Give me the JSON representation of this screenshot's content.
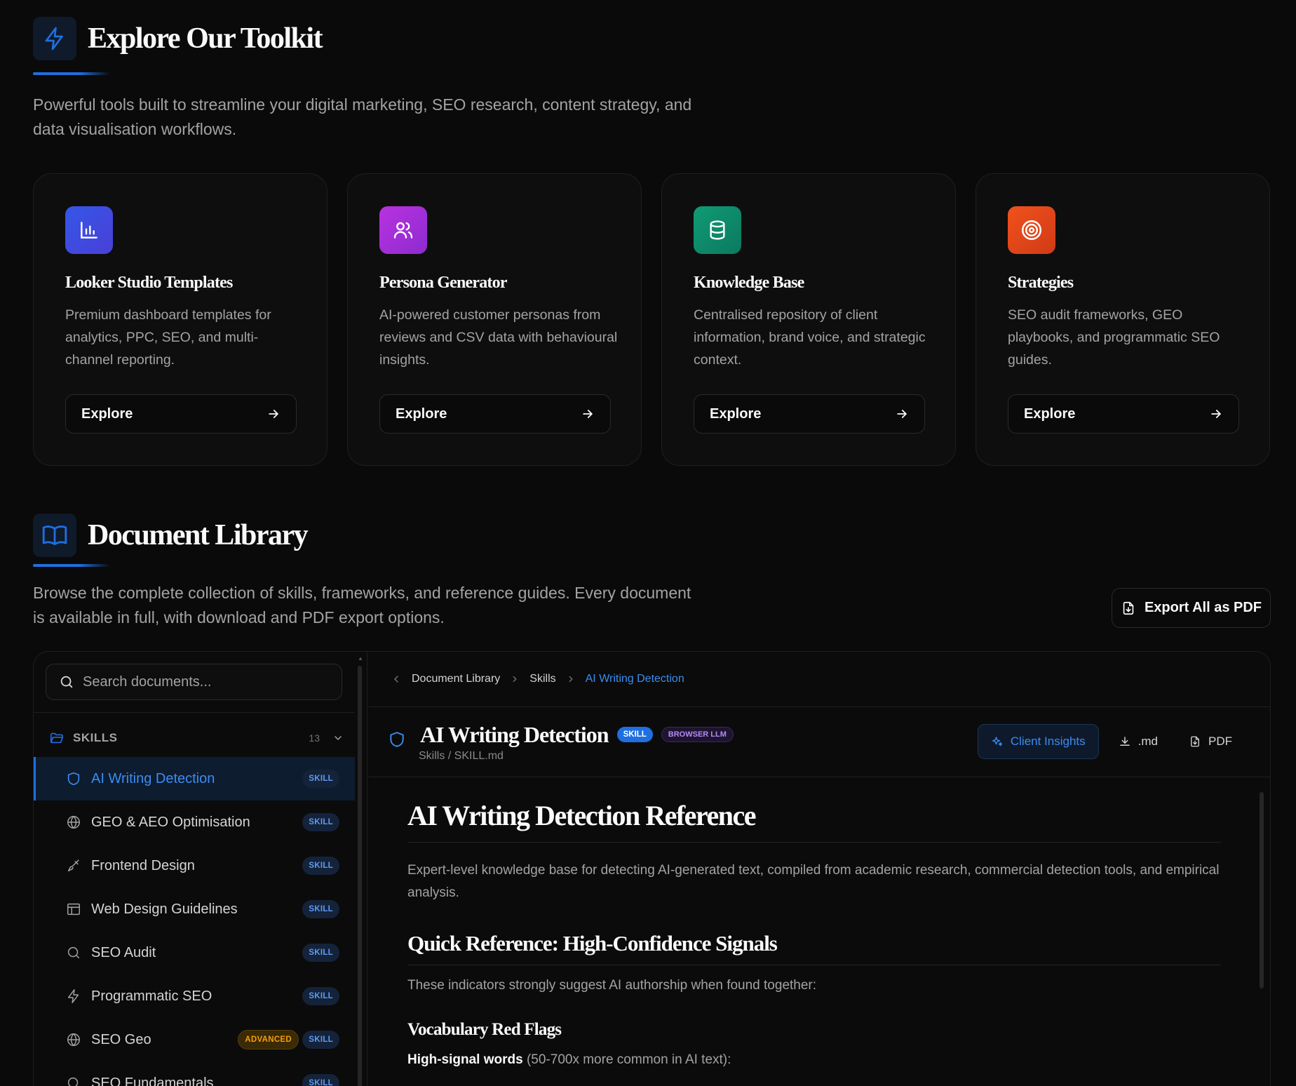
{
  "toolkit": {
    "title": "Explore Our Toolkit",
    "description": "Powerful tools built to streamline your digital marketing, SEO research, content strategy, and data visualisation workflows.",
    "cards": [
      {
        "title": "Looker Studio Templates",
        "description": "Premium dashboard templates for analytics, PPC, SEO, and multi-channel reporting.",
        "button": "Explore",
        "icon": "bar-chart-icon",
        "color": "#3b4fe0"
      },
      {
        "title": "Persona Generator",
        "description": "AI-powered customer personas from reviews and CSV data with behavioural insights.",
        "button": "Explore",
        "icon": "users-icon",
        "color": "#a32fd6"
      },
      {
        "title": "Knowledge Base",
        "description": "Centralised repository of client information, brand voice, and strategic context.",
        "button": "Explore",
        "icon": "database-icon",
        "color": "#0f8a6a"
      },
      {
        "title": "Strategies",
        "description": "SEO audit frameworks, GEO playbooks, and programmatic SEO guides.",
        "button": "Explore",
        "icon": "target-icon",
        "color": "#e0461a"
      }
    ]
  },
  "library": {
    "title": "Document Library",
    "description": "Browse the complete collection of skills, frameworks, and reference guides. Every document is available in full, with download and PDF export options.",
    "export_label": "Export All as PDF",
    "search_placeholder": "Search documents...",
    "group": {
      "label": "SKILLS",
      "count": "13"
    },
    "items": [
      {
        "name": "AI Writing Detection",
        "badge": "SKILL",
        "icon": "shield-icon"
      },
      {
        "name": "GEO & AEO Optimisation",
        "badge": "SKILL",
        "icon": "globe-icon"
      },
      {
        "name": "Frontend Design",
        "badge": "SKILL",
        "icon": "brush-icon"
      },
      {
        "name": "Web Design Guidelines",
        "badge": "SKILL",
        "icon": "layout-icon"
      },
      {
        "name": "SEO Audit",
        "badge": "SKILL",
        "icon": "search-icon"
      },
      {
        "name": "Programmatic SEO",
        "badge": "SKILL",
        "icon": "zap-icon"
      },
      {
        "name": "SEO Geo",
        "badge": "SKILL",
        "extra_badge": "ADVANCED",
        "icon": "globe-icon"
      },
      {
        "name": "SEO Fundamentals",
        "badge": "SKILL",
        "icon": "search-icon"
      }
    ],
    "breadcrumb": [
      "Document Library",
      "Skills",
      "AI Writing Detection"
    ],
    "doc": {
      "title": "AI Writing Detection",
      "badge_skill": "SKILL",
      "badge_llm": "BROWSER LLM",
      "path": "Skills / SKILL.md",
      "actions": {
        "client_insights": "Client Insights",
        "md": ".md",
        "pdf": "PDF"
      },
      "h1": "AI Writing Detection Reference",
      "intro": "Expert-level knowledge base for detecting AI-generated text, compiled from academic research, commercial detection tools, and empirical analysis.",
      "h2": "Quick Reference: High-Confidence Signals",
      "p2": "These indicators strongly suggest AI authorship when found together:",
      "h3": "Vocabulary Red Flags",
      "bold_lead": "High-signal words",
      "bold_rest": " (50-700x more common in AI text):"
    }
  }
}
